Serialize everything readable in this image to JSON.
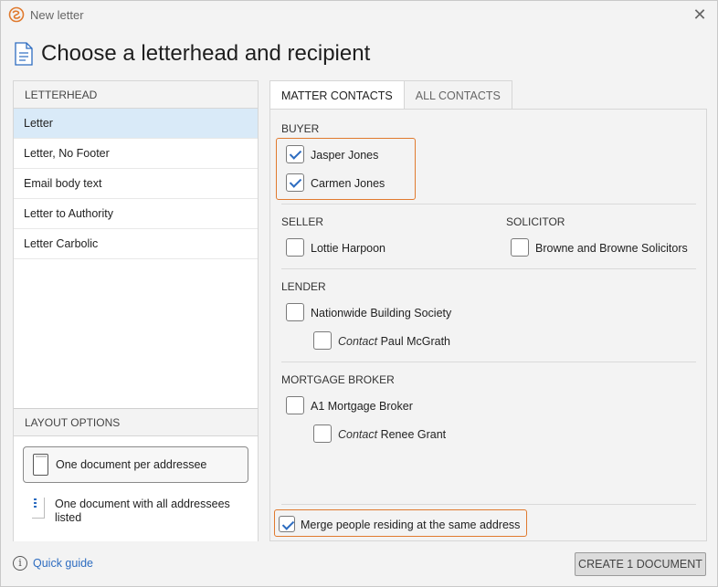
{
  "window": {
    "title": "New letter",
    "icons": {
      "app": "app-logo-icon",
      "close": "close-icon"
    }
  },
  "heading": {
    "title": "Choose a letterhead and recipient",
    "icon": "document-icon"
  },
  "letterhead": {
    "header": "LETTERHEAD",
    "items": [
      {
        "label": "Letter",
        "selected": true
      },
      {
        "label": "Letter, No Footer",
        "selected": false
      },
      {
        "label": "Email body text",
        "selected": false
      },
      {
        "label": "Letter to Authority",
        "selected": false
      },
      {
        "label": "Letter Carbolic",
        "selected": false
      }
    ]
  },
  "layout_options": {
    "header": "LAYOUT OPTIONS",
    "options": [
      {
        "label": "One document per addressee",
        "selected": true
      },
      {
        "label": "One document with all addressees listed",
        "selected": false
      }
    ]
  },
  "tabs": [
    {
      "label": "MATTER CONTACTS",
      "active": true
    },
    {
      "label": "ALL CONTACTS",
      "active": false
    }
  ],
  "contacts": {
    "buyer": {
      "label": "BUYER",
      "items": [
        {
          "name": "Jasper Jones",
          "checked": true
        },
        {
          "name": "Carmen Jones",
          "checked": true
        }
      ]
    },
    "seller": {
      "label": "SELLER",
      "items": [
        {
          "name": "Lottie Harpoon",
          "checked": false
        }
      ]
    },
    "solicitor": {
      "label": "SOLICITOR",
      "items": [
        {
          "name": "Browne and Browne Solicitors",
          "checked": false
        }
      ]
    },
    "lender": {
      "label": "LENDER",
      "items": [
        {
          "name": "Nationwide Building Society",
          "checked": false
        }
      ],
      "contact": {
        "prefix": "Contact",
        "name": "Paul McGrath",
        "checked": false
      }
    },
    "mortgage_broker": {
      "label": "MORTGAGE BROKER",
      "items": [
        {
          "name": "A1 Mortgage Broker",
          "checked": false
        }
      ],
      "contact": {
        "prefix": "Contact",
        "name": "Renee Grant",
        "checked": false
      }
    }
  },
  "merge_option": {
    "label": "Merge people residing at the same address",
    "checked": true
  },
  "footer": {
    "quick_guide": "Quick guide",
    "create_button": "CREATE 1 DOCUMENT"
  },
  "colors": {
    "accent": "#2d6cc0",
    "selection": "#d9eaf8",
    "highlight": "#e07a2e",
    "app_logo": "#e07a2e"
  }
}
